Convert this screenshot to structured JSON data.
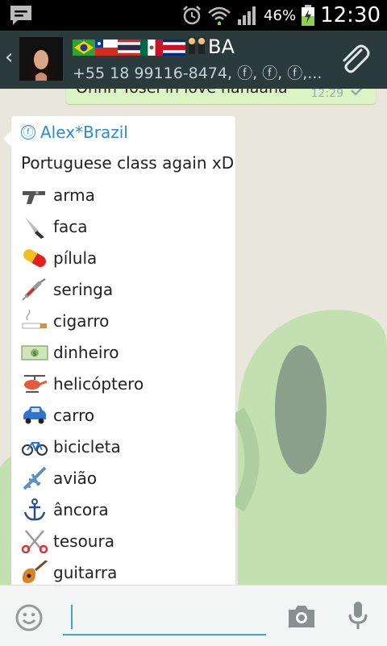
{
  "status_bar": {
    "battery_percent": "46%",
    "time": "12:30",
    "icons": [
      "chat-notification-icon",
      "alarm-icon",
      "wifi-icon",
      "cell-signal-icon",
      "battery-icon"
    ]
  },
  "header": {
    "title_suffix": "BA",
    "title_emoji": [
      "flag-brazil",
      "flag-chile",
      "flag-thailand",
      "flag-mexico",
      "flag-costa-rica",
      "dancers"
    ],
    "subtitle": "+55 18 99116-8474, ⓕ, ⓕ, ⓕ,...",
    "icons": [
      "back-chevron-icon",
      "group-avatar",
      "attach-paperclip-icon"
    ]
  },
  "chat": {
    "outgoing": {
      "text": "Ohhh Yosel in love hahaaha",
      "time": "12:29"
    },
    "incoming": {
      "sender_icon": "ⓕ",
      "sender": "Alex*Brazil",
      "first_line": "Portuguese class again xD",
      "items": [
        {
          "emoji": "pistol",
          "label": "arma"
        },
        {
          "emoji": "knife",
          "label": "faca"
        },
        {
          "emoji": "pill",
          "label": "pílula"
        },
        {
          "emoji": "syringe",
          "label": "seringa"
        },
        {
          "emoji": "cigarette",
          "label": "cigarro"
        },
        {
          "emoji": "dollar-banknote",
          "label": "dinheiro"
        },
        {
          "emoji": "helicopter",
          "label": "helicóptero"
        },
        {
          "emoji": "car",
          "label": "carro"
        },
        {
          "emoji": "bicycle",
          "label": "bicicleta"
        },
        {
          "emoji": "airplane",
          "label": "avião"
        },
        {
          "emoji": "anchor",
          "label": "âncora"
        },
        {
          "emoji": "scissors",
          "label": "tesoura"
        },
        {
          "emoji": "guitar",
          "label": "guitarra"
        }
      ]
    }
  },
  "input_bar": {
    "value": "",
    "icons": [
      "smiley-icon",
      "camera-icon",
      "microphone-icon"
    ]
  },
  "colors": {
    "header_bg": "#2b3a3d",
    "outgoing_bubble": "#dcf4c4",
    "sender_name": "#2a8bd6",
    "input_accent": "#38a8d6",
    "wallpaper_blob": "#c2e0b0"
  }
}
